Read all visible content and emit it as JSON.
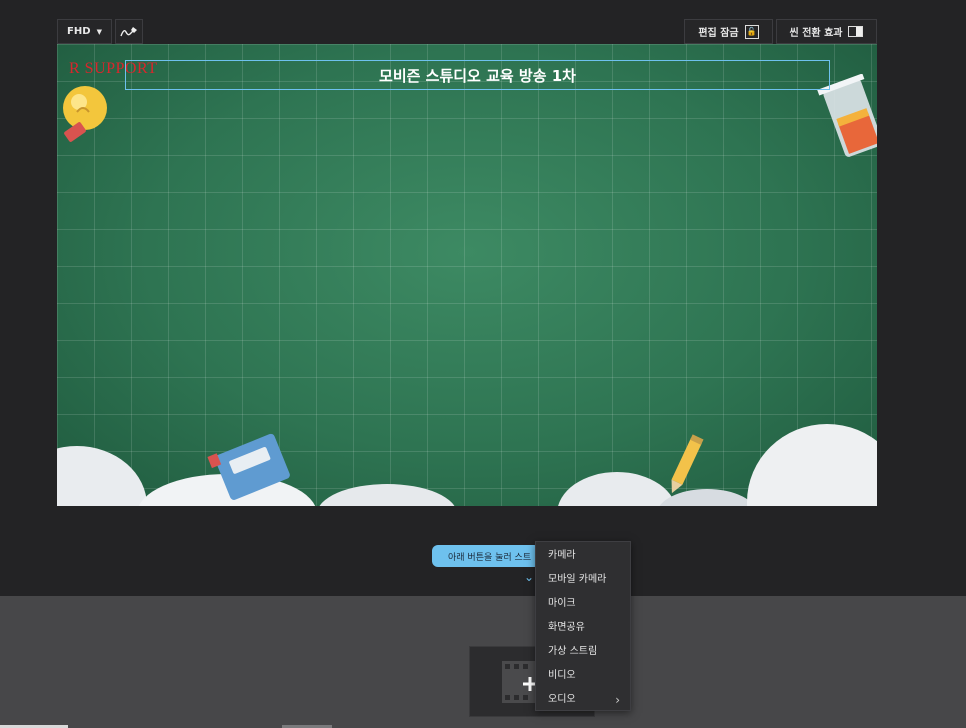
{
  "toolbar": {
    "resolution_label": "FHD",
    "resolution_arrow": "▼",
    "pen_icon": "pen-icon",
    "edit_lock_label": "편집 잠금",
    "edit_lock_icon": "lock-icon",
    "scene_transition_label": "씬 전환 효과",
    "scene_transition_icon": "toggle-icon"
  },
  "canvas": {
    "logo_text": "R SUPPORT",
    "title": "모비즌 스튜디오 교육 방송 1차",
    "background_color": "#2e7452",
    "selection_color": "#6ec1ee"
  },
  "hint": {
    "text": "아래 버튼을 눌러 스트"
  },
  "source_menu": {
    "items": [
      {
        "label": "카메라"
      },
      {
        "label": "모바일 카메라"
      },
      {
        "label": "마이크"
      },
      {
        "label": "화면공유"
      },
      {
        "label": "가상 스트림"
      },
      {
        "label": "비디오"
      },
      {
        "label": "오디오",
        "submenu_arrow": "›"
      }
    ]
  },
  "add_source": {
    "icon": "film-plus-icon"
  },
  "colors": {
    "accent": "#6ec1ee",
    "app_background": "#232325",
    "scene_panel": "#474749"
  }
}
